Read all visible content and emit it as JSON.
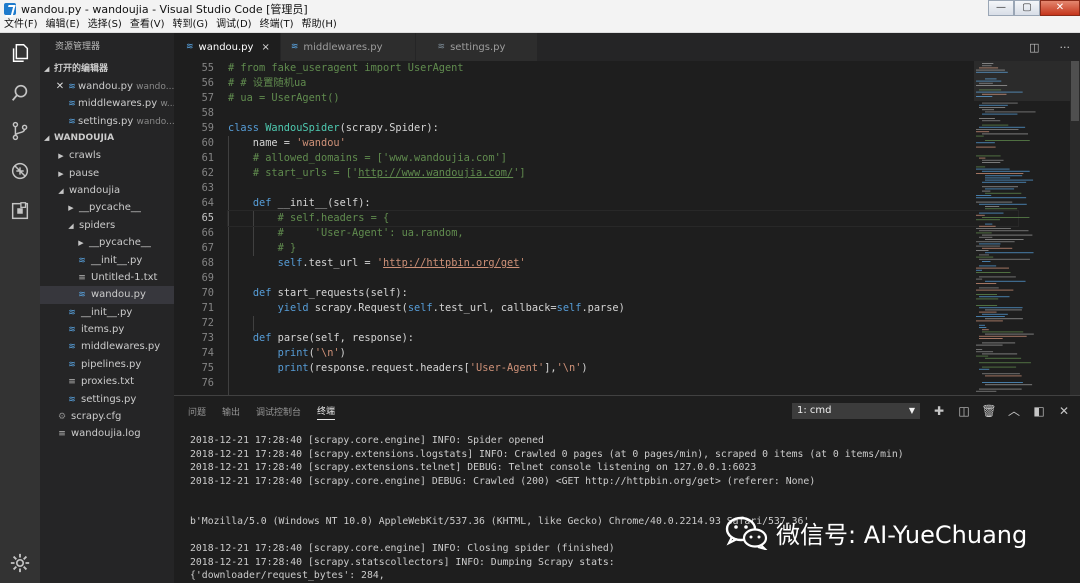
{
  "window": {
    "title": "wandou.py - wandoujia - Visual Studio Code [管理员]",
    "controls": [
      "—",
      "▢",
      "✕"
    ]
  },
  "menu": [
    "文件(F)",
    "编辑(E)",
    "选择(S)",
    "查看(V)",
    "转到(G)",
    "调试(D)",
    "终端(T)",
    "帮助(H)"
  ],
  "activity_bar": [
    "files-icon",
    "search-icon",
    "source-control-icon",
    "debug-icon",
    "extensions-icon"
  ],
  "sidebar": {
    "title": "资源管理器",
    "open_editors": {
      "header": "打开的编辑器",
      "items": [
        {
          "name": "wandou.py",
          "hint": "wando..."
        },
        {
          "name": "middlewares.py",
          "hint": "w..."
        },
        {
          "name": "settings.py",
          "hint": "wando..."
        }
      ]
    },
    "project": {
      "header": "WANDOUJIA",
      "items": [
        {
          "label": "crawls",
          "kind": "folder",
          "state": "collapsed",
          "depth": 0
        },
        {
          "label": "pause",
          "kind": "folder",
          "state": "collapsed",
          "depth": 0
        },
        {
          "label": "wandoujia",
          "kind": "folder",
          "state": "expanded",
          "depth": 0
        },
        {
          "label": "__pycache__",
          "kind": "folder",
          "state": "collapsed",
          "depth": 1
        },
        {
          "label": "spiders",
          "kind": "folder",
          "state": "expanded",
          "depth": 1
        },
        {
          "label": "__pycache__",
          "kind": "folder",
          "state": "collapsed",
          "depth": 2
        },
        {
          "label": "__init__.py",
          "kind": "py",
          "depth": 2
        },
        {
          "label": "Untitled-1.txt",
          "kind": "txt",
          "depth": 2
        },
        {
          "label": "wandou.py",
          "kind": "py",
          "depth": 2,
          "active": true
        },
        {
          "label": "__init__.py",
          "kind": "py",
          "depth": 1
        },
        {
          "label": "items.py",
          "kind": "py",
          "depth": 1
        },
        {
          "label": "middlewares.py",
          "kind": "py",
          "depth": 1
        },
        {
          "label": "pipelines.py",
          "kind": "py",
          "depth": 1
        },
        {
          "label": "proxies.txt",
          "kind": "txt",
          "depth": 1
        },
        {
          "label": "settings.py",
          "kind": "py",
          "depth": 1
        },
        {
          "label": "scrapy.cfg",
          "kind": "cfg",
          "depth": 0
        },
        {
          "label": "wandoujia.log",
          "kind": "txt",
          "depth": 0
        }
      ]
    }
  },
  "tabs": [
    {
      "label": "wandou.py",
      "active": true,
      "close": "×"
    },
    {
      "label": "middlewares.py",
      "active": false
    },
    {
      "label": "settings.py",
      "active": false
    }
  ],
  "editor": {
    "current_line": 65,
    "lines": [
      {
        "n": "55",
        "html": "<span class=\"cm\"># from fake_useragent import UserAgent</span>"
      },
      {
        "n": "56",
        "html": "<span class=\"cm\"># # 设置随机ua</span>"
      },
      {
        "n": "57",
        "html": "<span class=\"cm\"># ua = UserAgent()</span>"
      },
      {
        "n": "58",
        "html": ""
      },
      {
        "n": "59",
        "html": "<span class=\"kw\">class</span> <span class=\"cls\">WandouSpider</span>(scrapy.Spider):"
      },
      {
        "n": "60",
        "html": "    name = <span class=\"str\">'wandou'</span>"
      },
      {
        "n": "61",
        "html": "    <span class=\"cm\"># allowed_domains = ['www.wandoujia.com']</span>"
      },
      {
        "n": "62",
        "html": "    <span class=\"cm\"># start_urls = ['<span class=\"url\">http://www.wandoujia.com/</span>']</span>"
      },
      {
        "n": "63",
        "html": ""
      },
      {
        "n": "64",
        "html": "    <span class=\"kw\">def</span> __init__(self):"
      },
      {
        "n": "65",
        "html": "        <span class=\"cm\"># self.headers = {</span>"
      },
      {
        "n": "66",
        "html": "        <span class=\"cm\">#     'User-Agent': ua.random,</span>"
      },
      {
        "n": "67",
        "html": "        <span class=\"cm\"># }</span>"
      },
      {
        "n": "68",
        "html": "        <span class=\"slf\">self</span>.test_url = <span class=\"str\">'<span class=\"url\">http://httpbin.org/get</span>'</span>"
      },
      {
        "n": "69",
        "html": ""
      },
      {
        "n": "70",
        "html": "    <span class=\"kw\">def</span> start_requests(self):"
      },
      {
        "n": "71",
        "html": "        <span class=\"kw\">yield</span> scrapy.Request(<span class=\"slf\">self</span>.test_url, callback=<span class=\"slf\">self</span>.parse)"
      },
      {
        "n": "72",
        "html": ""
      },
      {
        "n": "73",
        "html": "    <span class=\"kw\">def</span> parse(self, response):"
      },
      {
        "n": "74",
        "html": "        <span class=\"kw\">print</span>(<span class=\"str\">'\\n'</span>)"
      },
      {
        "n": "75",
        "html": "        <span class=\"kw\">print</span>(response.request.headers[<span class=\"str\">'User-Agent'</span>],<span class=\"str\">'\\n'</span>)"
      },
      {
        "n": "76",
        "html": ""
      }
    ]
  },
  "panel": {
    "tabs": [
      "问题",
      "输出",
      "调试控制台",
      "终端"
    ],
    "active_tab": "终端",
    "terminal_select": "1: cmd",
    "actions": [
      "add-terminal-icon",
      "split-terminal-icon",
      "trash-icon",
      "maximize-panel-icon",
      "toggle-panel-icon",
      "close-panel-icon"
    ],
    "terminal_lines": [
      "2018-12-21 17:28:40 [scrapy.core.engine] INFO: Spider opened",
      "2018-12-21 17:28:40 [scrapy.extensions.logstats] INFO: Crawled 0 pages (at 0 pages/min), scraped 0 items (at 0 items/min)",
      "2018-12-21 17:28:40 [scrapy.extensions.telnet] DEBUG: Telnet console listening on 127.0.0.1:6023",
      "2018-12-21 17:28:40 [scrapy.core.engine] DEBUG: Crawled (200) <GET http://httpbin.org/get> (referer: None)",
      "",
      "",
      "b'Mozilla/5.0 (Windows NT 10.0) AppleWebKit/537.36 (KHTML, like Gecko) Chrome/40.0.2214.93 Safari/537.36'",
      "",
      "2018-12-21 17:28:40 [scrapy.core.engine] INFO: Closing spider (finished)",
      "2018-12-21 17:28:40 [scrapy.statscollectors] INFO: Dumping Scrapy stats:",
      "{'downloader/request_bytes': 284,"
    ]
  },
  "watermark": "微信号: AI-YueChuang",
  "colors": {
    "keyword": "#569cd6",
    "comment": "#608b4e",
    "string": "#ce9178",
    "class": "#4ec9b0",
    "python_icon": "#5aa7e6"
  }
}
